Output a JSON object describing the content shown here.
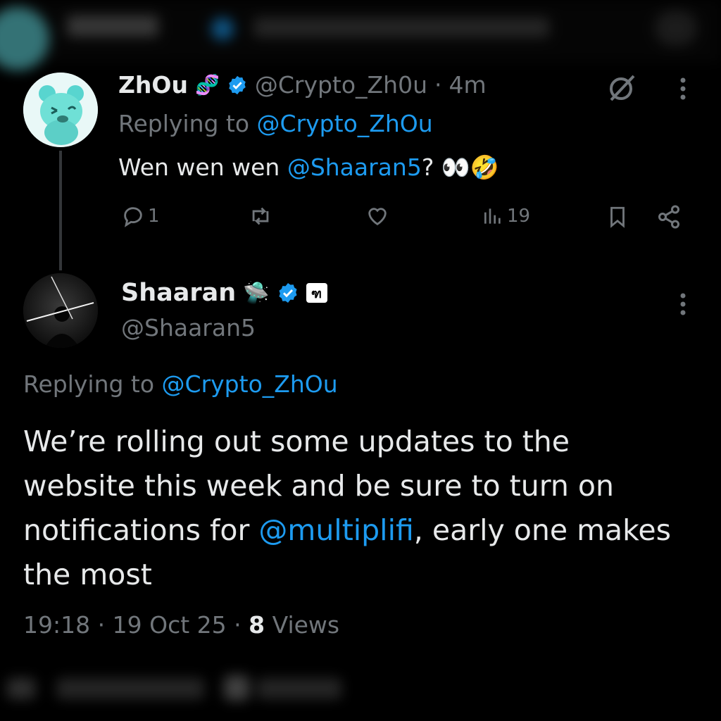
{
  "parent_tweet": {
    "display_name": "ZhOu",
    "name_emoji": "🧬",
    "handle": "@Crypto_Zh0u",
    "separator": "·",
    "time": "4m",
    "replying_prefix": "Replying to",
    "replying_handle": "@Crypto_ZhOu",
    "text_before": "Wen wen wen ",
    "mention": "@Shaaran5",
    "text_after": "? 👀🤣",
    "actions": {
      "replies": "1",
      "views": "19"
    }
  },
  "main_tweet": {
    "display_name": "Shaaran",
    "name_emoji": "🛸",
    "badge_text": "ฑ",
    "handle": "@Shaaran5",
    "replying_prefix": "Replying to",
    "replying_handle": "@Crypto_ZhOu",
    "body_part1": "We’re rolling out some updates to the website this week and be sure to turn on notifications for ",
    "body_mention": "@multiplifi",
    "body_part2": ", early one makes the most",
    "time": "19:18",
    "separator": "·",
    "date": "19 Oct 25",
    "views_count": "8",
    "views_label": "Views"
  },
  "colors": {
    "background": "#000000",
    "text": "#e7e9ea",
    "muted": "#71767b",
    "link": "#1d9bf0",
    "verified": "#1d9bf0"
  },
  "icons": [
    "grok-icon",
    "more-icon",
    "reply-icon",
    "retweet-icon",
    "like-icon",
    "views-icon",
    "bookmark-icon",
    "share-icon",
    "verified-icon"
  ]
}
